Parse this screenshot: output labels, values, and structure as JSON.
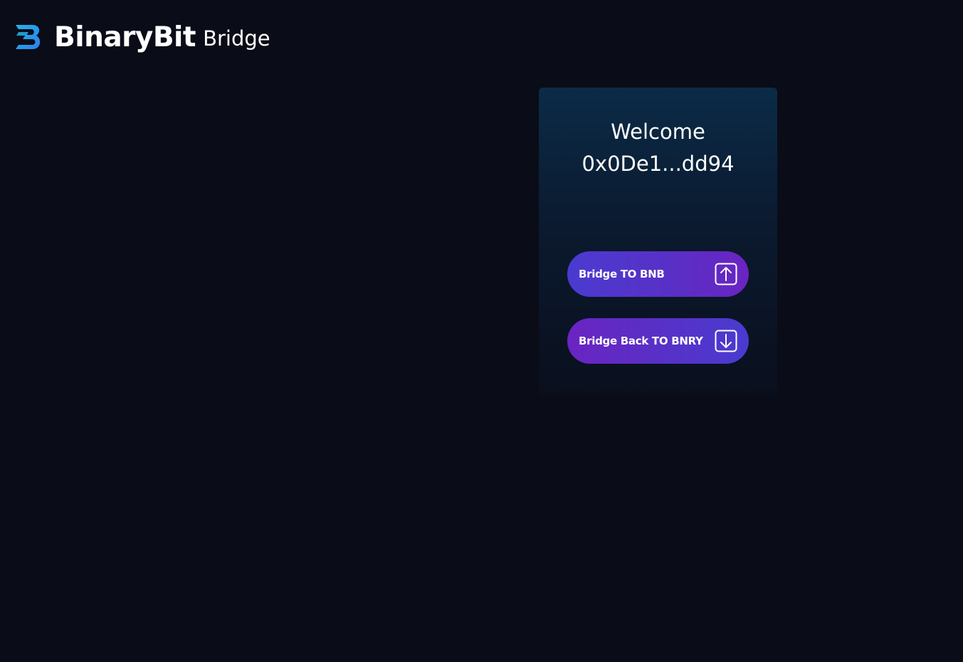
{
  "header": {
    "logo_icon": "binarybit-logo-icon",
    "brand_name": "BinaryBit",
    "brand_sub": "Bridge"
  },
  "card": {
    "welcome": "Welcome",
    "address": "0x0De1...dd94",
    "buttons": [
      {
        "label": "Bridge TO BNB",
        "icon": "arrow-up-box-icon"
      },
      {
        "label": "Bridge Back TO BNRY",
        "icon": "arrow-down-box-icon"
      }
    ]
  },
  "colors": {
    "background": "#0a0c17",
    "logo_blue": "#2ba3f0",
    "button_purple": "#5a2fc6",
    "button_indigo": "#4a3bd0"
  }
}
